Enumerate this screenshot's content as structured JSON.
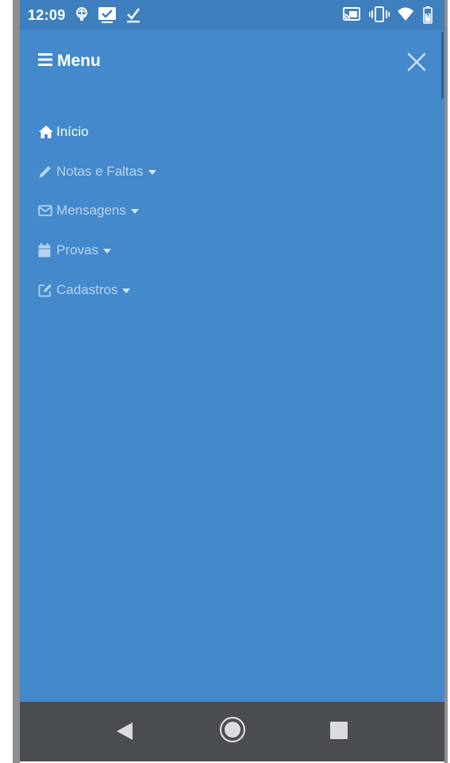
{
  "status_bar": {
    "time": "12:09",
    "left_icons": [
      "brain-icon",
      "mail-check-icon",
      "checkmark-icon"
    ],
    "right_icons": [
      "cast-icon",
      "vibrate-icon",
      "wifi-icon",
      "battery-icon"
    ]
  },
  "menu": {
    "title": "Menu",
    "menu_icon": "hamburger-icon",
    "close_icon": "close-icon"
  },
  "nav_items": [
    {
      "label": "Início",
      "icon": "home-icon",
      "active": true,
      "has_dropdown": false
    },
    {
      "label": "Notas e Faltas",
      "icon": "pencil-icon",
      "active": false,
      "has_dropdown": true
    },
    {
      "label": "Mensagens",
      "icon": "envelope-icon",
      "active": false,
      "has_dropdown": true
    },
    {
      "label": "Provas",
      "icon": "calendar-icon",
      "active": false,
      "has_dropdown": true
    },
    {
      "label": "Cadastros",
      "icon": "edit-icon",
      "active": false,
      "has_dropdown": true
    }
  ],
  "android_nav": {
    "buttons": [
      "back-icon",
      "home-circle-icon",
      "recents-icon"
    ]
  },
  "colors": {
    "background": "#4389cc",
    "status_bar": "#3f7fbd",
    "nav_bar": "#4a4e53",
    "active_text": "#ffffff",
    "inactive_text": "#b8d2ec"
  }
}
